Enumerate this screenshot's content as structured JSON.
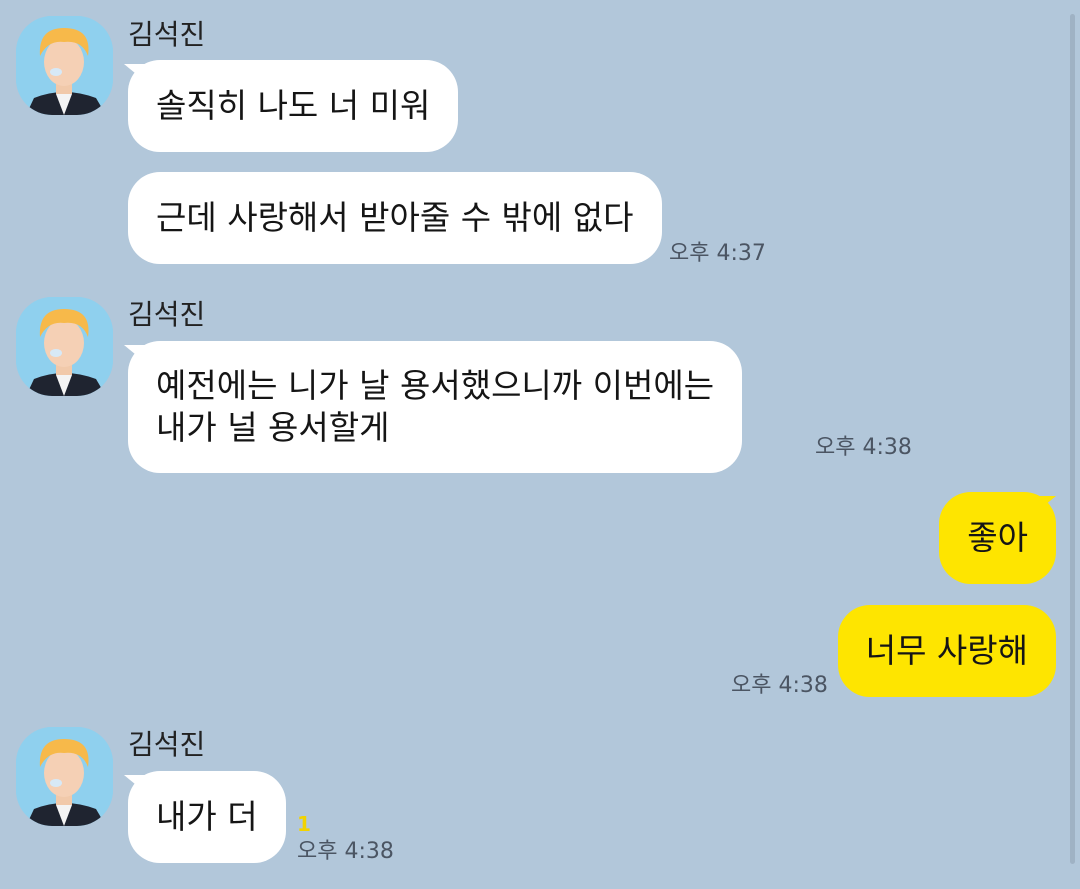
{
  "theme": {
    "background": "#b2c7da",
    "incoming_bubble": "#ffffff",
    "outgoing_bubble": "#fee500",
    "unread_color": "#f2d300"
  },
  "groups": [
    {
      "sender": "김석진",
      "messages": [
        "솔직히 나도 너 미워",
        "근데 사랑해서 받아줄 수 밖에 없다"
      ],
      "time": "오후 4:37"
    },
    {
      "sender": "김석진",
      "messages": [
        "예전에는 니가 날 용서했으니까 이번에는\n내가 널 용서할게"
      ],
      "time": "오후 4:38"
    },
    {
      "sender": "me",
      "messages": [
        "좋아",
        "너무 사랑해"
      ],
      "time": "오후 4:38"
    },
    {
      "sender": "김석진",
      "messages": [
        "내가 더"
      ],
      "unread": "1",
      "time": "오후 4:38"
    }
  ]
}
